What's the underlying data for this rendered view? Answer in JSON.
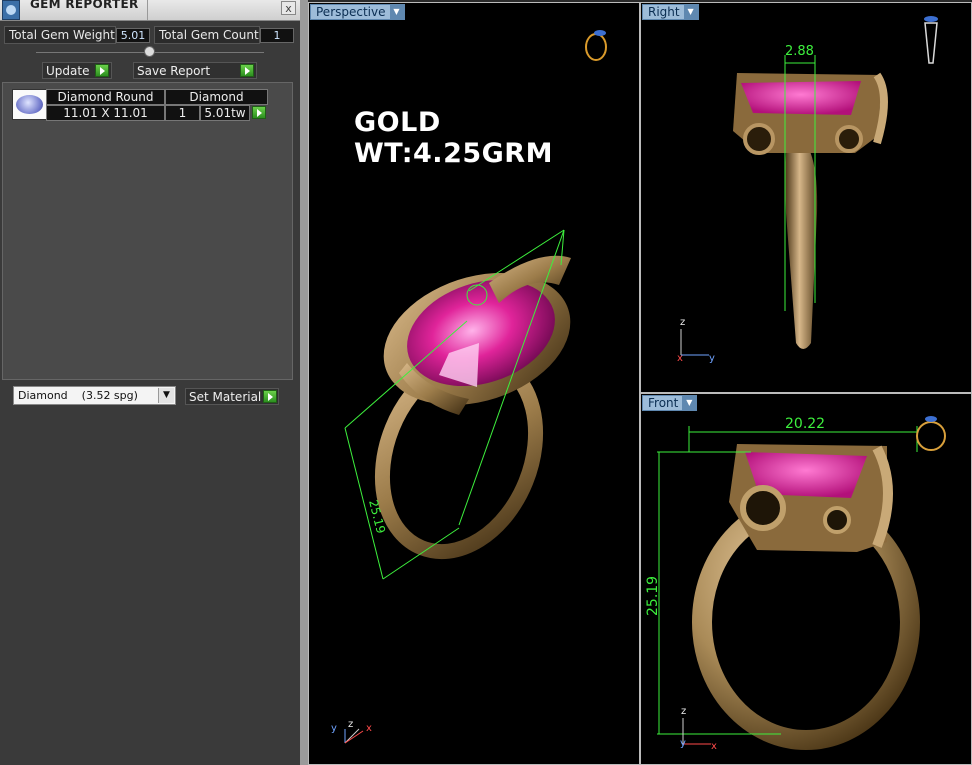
{
  "panel": {
    "title": "GEM REPORTER",
    "close_label": "x",
    "total_weight_label": "Total Gem Weight",
    "total_weight_value": "5.01",
    "total_count_label": "Total Gem Count",
    "total_count_value": "1",
    "update_label": "Update",
    "save_report_label": "Save Report",
    "gem_rows": [
      {
        "name": "Diamond Round",
        "size": "11.01 X 11.01",
        "type": "Diamond",
        "count": "1",
        "weight": "5.01tw"
      }
    ],
    "material_select": "Diamond    (3.52 spg)",
    "set_material_label": "Set Material"
  },
  "viewports": {
    "perspective": {
      "tab": "Perspective",
      "gold_weight_label": "GOLD WT:4.25GRM",
      "dimension": "25.19"
    },
    "right": {
      "tab": "Right",
      "dimension": "2.88"
    },
    "front": {
      "tab": "Front",
      "width_dimension": "20.22",
      "height_dimension": "25.19"
    }
  },
  "axis_labels": {
    "x": "x",
    "y": "y",
    "z": "z"
  },
  "colors": {
    "gold": "#9c7c4a",
    "gem": "#e0249a",
    "dimension": "#3df03d",
    "tab": "#9dbcd9"
  }
}
